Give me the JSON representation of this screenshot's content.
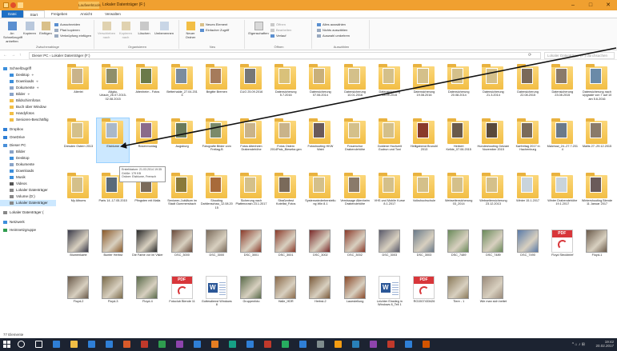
{
  "window": {
    "context_tab": "Laufwerktools",
    "title": "Lokaler Datenträger (F:)",
    "minimize": "–",
    "maximize": "□",
    "close": "✕"
  },
  "ribbon_tabs": [
    "Datei",
    "Start",
    "Freigeben",
    "Ansicht",
    "Verwalten"
  ],
  "ribbon": {
    "groups": [
      "Zwischenablage",
      "Organisieren",
      "Neu",
      "Öffnen",
      "Auswählen"
    ],
    "pin_label": "An Schnellzugriff anheften",
    "copy_label": "Kopieren",
    "paste_label": "Einfügen",
    "cut_label": "Ausschneiden",
    "copy_path_label": "Pfad kopieren",
    "paste_link_label": "Verknüpfung einfügen",
    "move_label": "Verschieben nach",
    "copyto_label": "Kopieren nach",
    "delete_label": "Löschen",
    "rename_label": "Umbenennen",
    "newfolder_label": "Neuer Ordner",
    "newitem_label": "Neues Element",
    "easyaccess_label": "Einfacher Zugriff",
    "properties_label": "Eigenschaften",
    "open_label": "Öffnen",
    "edit_label": "Bearbeiten",
    "history_label": "Verlauf",
    "selectall_label": "Alles auswählen",
    "selectnone_label": "Nichts auswählen",
    "invert_label": "Auswahl umkehren"
  },
  "address": {
    "back": "←",
    "forward": "→",
    "up": "↑",
    "path": "Dieser PC › Lokaler Datenträger (F:)",
    "refresh": "⟳",
    "search_placeholder": "Lokaler Datenträger (F:) durchsuchen"
  },
  "sidebar": [
    {
      "label": "Schnellzugriff",
      "icon": "star-icon",
      "color": "#3c8fdc",
      "pinned": false
    },
    {
      "label": "Desktop",
      "icon": "desktop-icon",
      "color": "#3c8fdc",
      "pinned": true
    },
    {
      "label": "Downloads",
      "icon": "download-icon",
      "color": "#3c8fdc",
      "pinned": true
    },
    {
      "label": "Dokumente",
      "icon": "documents-icon",
      "color": "#8aa4c8",
      "pinned": true
    },
    {
      "label": "Bilder",
      "icon": "pictures-icon",
      "color": "#8aa4c8",
      "pinned": true
    },
    {
      "label": "Bildschirmfotos",
      "icon": "folder-icon",
      "color": "#f2be45",
      "pinned": false
    },
    {
      "label": "Buch über Window",
      "icon": "folder-icon",
      "color": "#f2be45",
      "pinned": false
    },
    {
      "label": "Handyfotos",
      "icon": "folder-icon",
      "color": "#f2be45",
      "pinned": false
    },
    {
      "label": "Senioren-Beschäftig",
      "icon": "folder-icon",
      "color": "#f2be45",
      "pinned": false
    },
    {
      "label": "Dropbox",
      "icon": "dropbox-icon",
      "color": "#2f7fd6",
      "pinned": false
    },
    {
      "label": "OneDrive",
      "icon": "cloud-icon",
      "color": "#2f7fd6",
      "pinned": false
    },
    {
      "label": "Dieser PC",
      "icon": "computer-icon",
      "color": "#4a90d9",
      "pinned": false
    },
    {
      "label": "Bilder",
      "icon": "pictures-icon",
      "color": "#8aa4c8",
      "pinned": false
    },
    {
      "label": "Desktop",
      "icon": "desktop-icon",
      "color": "#3c8fdc",
      "pinned": false
    },
    {
      "label": "Dokumente",
      "icon": "documents-icon",
      "color": "#8aa4c8",
      "pinned": false
    },
    {
      "label": "Downloads",
      "icon": "download-icon",
      "color": "#3c8fdc",
      "pinned": false
    },
    {
      "label": "Musik",
      "icon": "music-icon",
      "color": "#3c8fdc",
      "pinned": false
    },
    {
      "label": "Videos",
      "icon": "video-icon",
      "color": "#555555",
      "pinned": false
    },
    {
      "label": "Lokaler Datenträger",
      "icon": "drive-icon",
      "color": "#888888",
      "pinned": false
    },
    {
      "label": "Volume (D:)",
      "icon": "drive-icon",
      "color": "#888888",
      "pinned": false
    },
    {
      "label": "Lokaler Datenträger",
      "icon": "drive-icon",
      "color": "#888888",
      "pinned": false
    },
    {
      "label": "Lokaler Datenträger (",
      "icon": "drive-icon",
      "color": "#888888",
      "pinned": false
    },
    {
      "label": "Netzwerk",
      "icon": "network-icon",
      "color": "#3c8fdc",
      "pinned": false
    },
    {
      "label": "Heimnetzgruppe",
      "icon": "homegroup-icon",
      "color": "#2f9d4f",
      "pinned": false
    }
  ],
  "sidebar_selected": 20,
  "pin_glyph": "⌖",
  "items": [
    {
      "label": "Allerlei",
      "type": "folder",
      "tint": "#c9b38a"
    },
    {
      "label": "Allgäu-Urlaub_26.07.2015-02.08.2015",
      "type": "folder",
      "tint": "#8f8f6a"
    },
    {
      "label": "Altenheim - Fotos",
      "type": "folder",
      "tint": "#6b7a4a"
    },
    {
      "label": "Betterhalde_27.04.2014",
      "type": "folder",
      "tint": "#7b8c9e"
    },
    {
      "label": "Brigitte Bremen",
      "type": "folder",
      "tint": "#a67b5b"
    },
    {
      "label": "CUG 25.09.2016",
      "type": "folder",
      "tint": "#777777"
    },
    {
      "label": "Datensicherung 5.7.2016",
      "type": "folder",
      "tint": "#d9c17a"
    },
    {
      "label": "Datensicherung 07.06.2014",
      "type": "folder",
      "tint": "#c9b07a"
    },
    {
      "label": "Datensicherung 10.01.2016",
      "type": "folder",
      "tint": "#d4c08a"
    },
    {
      "label": "Datensicherung 13.09.2015",
      "type": "folder",
      "tint": "#d4c08a"
    },
    {
      "label": "Datensicherung 19.08.2016",
      "type": "folder",
      "tint": "#d4c08a"
    },
    {
      "label": "Datensicherung 20.08.2014",
      "type": "folder",
      "tint": "#d4c08a"
    },
    {
      "label": "Datensicherung 21.3.2014",
      "type": "folder",
      "tint": "#d4c08a"
    },
    {
      "label": "Datensicherung 22.08.2015",
      "type": "folder",
      "tint": "#7a6a5a"
    },
    {
      "label": "Datensicherung 23.08.2015",
      "type": "folder",
      "tint": "#8a7a6a"
    },
    {
      "label": "Datensicherung nach Upgrade von 7 auf 10 am 5.6.2016",
      "type": "folder",
      "tint": "#6a8aa8"
    },
    {
      "label": "Dresden Ostern 2013",
      "type": "folder",
      "tint": "#d4c08a"
    },
    {
      "label": "Eisblume",
      "type": "folder",
      "tint": "#a9b8c9"
    },
    {
      "label": "Rosenmontag",
      "type": "folder",
      "tint": "#8a6a8a"
    },
    {
      "label": "Augsburg",
      "type": "folder",
      "tint": "#6a7a5a"
    },
    {
      "label": "Fotografie Bilder vom Freitag-B",
      "type": "folder",
      "tint": "#7a8a6a"
    },
    {
      "label": "Fotos Altenheim Drabendehöhe",
      "type": "folder",
      "tint": "#c9b38a"
    },
    {
      "label": "Fotos Ostern 2014Palz_Bieseba gen",
      "type": "folder",
      "tint": "#c9b38a"
    },
    {
      "label": "Fotoshooting HKW Wahl",
      "type": "folder",
      "tint": "#6a5a5a"
    },
    {
      "label": "Frauenchor Drabendehöhe",
      "type": "folder",
      "tint": "#d4c08a"
    },
    {
      "label": "Goldene Hochzeit Gudrun und Toni",
      "type": "folder",
      "tint": "#d4c08a"
    },
    {
      "label": "Heiligabend Brunohl 2013",
      "type": "folder",
      "tint": "#8a3a2a"
    },
    {
      "label": "Herbert Kelkle_07.06.2015",
      "type": "folder",
      "tint": "#6a5a4a"
    },
    {
      "label": "Hundeshooting Gelzam November 2015",
      "type": "folder",
      "tint": "#5a4a3a"
    },
    {
      "label": "Karfreitag 2017 in Hachenburg",
      "type": "folder",
      "tint": "#7a6a5a"
    },
    {
      "label": "Malchow_24.-27.7.2014",
      "type": "folder",
      "tint": "#6a7a8a"
    },
    {
      "label": "Mallis 27.-29.12.2015",
      "type": "folder",
      "tint": "#8a7a6a"
    },
    {
      "label": "Mobile PC-Kurs Frensch",
      "type": "folder",
      "tint": "#d4c08a"
    },
    {
      "label": "My Albums",
      "type": "folder",
      "tint": "#d4c08a"
    },
    {
      "label": "Paris 14.-17.05.2015",
      "type": "folder",
      "tint": "#5a6a7a"
    },
    {
      "label": "Pfingsten mit Malia",
      "type": "folder",
      "tint": "#7a6a5a"
    },
    {
      "label": "Senioren-Jubiläum im Stadt Gummersbach",
      "type": "folder",
      "tint": "#8a7a3a"
    },
    {
      "label": "Shooting Dahlienschau_12.08.2015",
      "type": "folder",
      "tint": "#a86a3a"
    },
    {
      "label": "Sicherung nach Plattencrash 23.1.2017",
      "type": "folder",
      "tint": "#d4c08a"
    },
    {
      "label": "Straßenfest Kotelfat_Fotos",
      "type": "folder",
      "tint": "#7a6a5a"
    },
    {
      "label": "Systemwiederherstellung Win 8.1",
      "type": "folder",
      "tint": "#d4c08a"
    },
    {
      "label": "Vernissage Altenheim Drabendehöhe",
      "type": "folder",
      "tint": "#8a7a6a"
    },
    {
      "label": "VHS und Mobile Kurse 8.1.2017",
      "type": "folder",
      "tint": "#d4c08a"
    },
    {
      "label": "Volkshochschule",
      "type": "folder",
      "tint": "#d4c08a"
    },
    {
      "label": "Webseitensicherung 03_2014",
      "type": "folder",
      "tint": "#d4c08a"
    },
    {
      "label": "Webseitensicherung 23.12.2013",
      "type": "folder",
      "tint": "#d4c08a"
    },
    {
      "label": "Winter 15.1.2017",
      "type": "folder",
      "tint": "#c9d4dc"
    },
    {
      "label": "Winter Drabendehöhe 19.1.2017",
      "type": "folder",
      "tint": "#c9d4dc"
    },
    {
      "label": "Wintershooting Blende 11 Januar 2017",
      "type": "folder",
      "tint": "#6a5a5a"
    },
    {
      "label": "Blumenkarte",
      "type": "photo",
      "tint": "#3a3a4a"
    },
    {
      "label": "Bunter Herbst",
      "type": "photo",
      "tint": "#8a5a2a"
    },
    {
      "label": "Die Farbe vor im Visier",
      "type": "photo",
      "tint": "#2a2a2a"
    },
    {
      "label": "DSC_3000",
      "type": "photo",
      "tint": "#6a4a3a"
    },
    {
      "label": "DSC_3000",
      "type": "photo",
      "tint": "#7a6a5a"
    },
    {
      "label": "DSC_3001",
      "type": "photo",
      "tint": "#8a3a2a"
    },
    {
      "label": "DSC_3001",
      "type": "photo",
      "tint": "#8a3a2a"
    },
    {
      "label": "DSC_3002",
      "type": "photo",
      "tint": "#7a2a2a"
    },
    {
      "label": "DSC_3002",
      "type": "photo",
      "tint": "#8a3a2a"
    },
    {
      "label": "DSC_3003",
      "type": "photo",
      "tint": "#5a5a6a"
    },
    {
      "label": "DSC_3003",
      "type": "photo",
      "tint": "#6a7a8a"
    },
    {
      "label": "DSC_7489",
      "type": "photo",
      "tint": "#6a8a5a"
    },
    {
      "label": "DSC_7489",
      "type": "photo",
      "tint": "#6a8a5a"
    },
    {
      "label": "DSC_7490",
      "type": "photo",
      "tint": "#5a7aa8"
    },
    {
      "label": "Floyd Steckbrief",
      "type": "pdf",
      "tint": "#d8363a"
    },
    {
      "label": "Floyd-1",
      "type": "photo",
      "tint": "#6a5a4a"
    },
    {
      "label": "Floyd-2",
      "type": "photo",
      "tint": "#6a5a4a"
    },
    {
      "label": "Floyd-3",
      "type": "photo",
      "tint": "#7a6a4a"
    },
    {
      "label": "Floyd-4",
      "type": "photo",
      "tint": "#5a6a4a"
    },
    {
      "label": "Fotoclub Blende 11",
      "type": "pdf",
      "tint": "#d8363a"
    },
    {
      "label": "Gottesdienst Windows 8",
      "type": "doc",
      "tint": "#2b5797"
    },
    {
      "label": "Gruppenfoto",
      "type": "photo",
      "tint": "#5a6a4a"
    },
    {
      "label": "Halle_HDR",
      "type": "photo",
      "tint": "#8a6a4a"
    },
    {
      "label": "Herbst-2",
      "type": "photo",
      "tint": "#7a5a3a"
    },
    {
      "label": "Lauestellung",
      "type": "photo",
      "tint": "#8a4a2a"
    },
    {
      "label": "Leichter Einstieg in Windows 8_Teil 1",
      "type": "doc",
      "tint": "#2b5797"
    },
    {
      "label": "RG1507433426",
      "type": "pdf",
      "tint": "#d8363a"
    },
    {
      "label": "Tiere - 1",
      "type": "photo",
      "tint": "#8a7a5a"
    },
    {
      "label": "Wie man sich bettet",
      "type": "photo",
      "tint": "#9a8a7a"
    }
  ],
  "selected_item": 17,
  "tooltip": {
    "line1": "Erstelldatum: 21.03.2014 19:35",
    "line2": "Größe: 179 KB",
    "line3": "Ordner: Eisblume, Frensch"
  },
  "status": "77 Elemente",
  "taskbar": {
    "apps": [
      {
        "name": "search-icon",
        "color": "#ffffff"
      },
      {
        "name": "taskview-icon",
        "color": "#ffffff"
      },
      {
        "name": "edge-icon",
        "color": "#2f7fd6"
      },
      {
        "name": "explorer-icon",
        "color": "#f2be45"
      },
      {
        "name": "store-icon",
        "color": "#2f7fd6"
      },
      {
        "name": "mail-icon",
        "color": "#2f7fd6"
      },
      {
        "name": "app-icon",
        "color": "#d85a2a"
      },
      {
        "name": "app-icon",
        "color": "#c0392b"
      },
      {
        "name": "app-icon",
        "color": "#2f9d4f"
      },
      {
        "name": "app-icon",
        "color": "#8e44ad"
      },
      {
        "name": "app-icon",
        "color": "#2f7fd6"
      },
      {
        "name": "app-icon",
        "color": "#e67e22"
      },
      {
        "name": "app-icon",
        "color": "#16a085"
      },
      {
        "name": "app-icon",
        "color": "#2f7fd6"
      },
      {
        "name": "app-icon",
        "color": "#c0392b"
      },
      {
        "name": "app-icon",
        "color": "#27ae60"
      },
      {
        "name": "app-icon",
        "color": "#2f7fd6"
      },
      {
        "name": "app-icon",
        "color": "#7f8c8d"
      },
      {
        "name": "app-icon",
        "color": "#f39c12"
      },
      {
        "name": "app-icon",
        "color": "#2980b9"
      },
      {
        "name": "app-icon",
        "color": "#8e44ad"
      },
      {
        "name": "app-icon",
        "color": "#c0392b"
      },
      {
        "name": "app-icon",
        "color": "#2f7fd6"
      },
      {
        "name": "app-icon",
        "color": "#d35400"
      }
    ],
    "tray_glyphs": "^ ⌂ ♪ ⊞",
    "time": "19:42",
    "date": "20.02.2017"
  }
}
